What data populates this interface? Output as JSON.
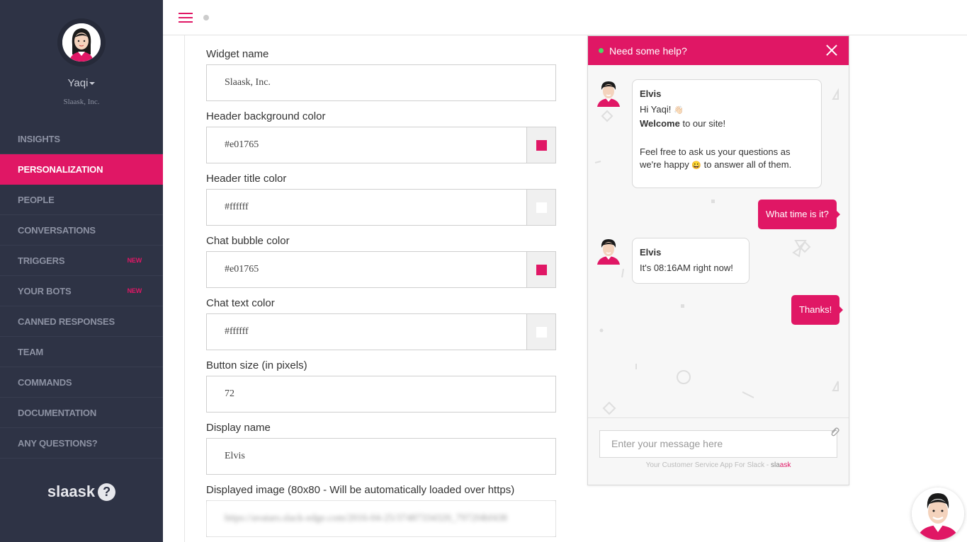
{
  "sidebar": {
    "user": {
      "name": "Yaqi",
      "org": "Slaask, Inc."
    },
    "items": [
      {
        "label": "INSIGHTS",
        "badge": ""
      },
      {
        "label": "PERSONALIZATION",
        "badge": ""
      },
      {
        "label": "PEOPLE",
        "badge": ""
      },
      {
        "label": "CONVERSATIONS",
        "badge": ""
      },
      {
        "label": "TRIGGERS",
        "badge": "NEW"
      },
      {
        "label": "YOUR BOTS",
        "badge": "NEW"
      },
      {
        "label": "CANNED RESPONSES",
        "badge": ""
      },
      {
        "label": "TEAM",
        "badge": ""
      },
      {
        "label": "COMMANDS",
        "badge": ""
      },
      {
        "label": "DOCUMENTATION",
        "badge": ""
      },
      {
        "label": "ANY QUESTIONS?",
        "badge": ""
      }
    ],
    "brand": "slaask",
    "brand_mark": "?"
  },
  "form": {
    "widget_name": {
      "label": "Widget name",
      "value": "Slaask, Inc."
    },
    "header_bg_color": {
      "label": "Header background color",
      "value": "#e01765"
    },
    "header_title_color": {
      "label": "Header title color",
      "value": "#ffffff"
    },
    "chat_bubble_color": {
      "label": "Chat bubble color",
      "value": "#e01765"
    },
    "chat_text_color": {
      "label": "Chat text color",
      "value": "#ffffff"
    },
    "button_size": {
      "label": "Button size (in pixels)",
      "value": "72"
    },
    "display_name": {
      "label": "Display name",
      "value": "Elvis"
    },
    "displayed_image": {
      "label": "Displayed image (80x80 - Will be automatically loaded over https)",
      "value": "https://avatars.slack-edge.com/2016-04-25/37487334320_7972f4bf438"
    }
  },
  "widget": {
    "title": "Need some help?",
    "messages": [
      {
        "sender": "Elvis",
        "line1_prefix": "Hi Yaqi! ",
        "line1_emoji": "👋🏻",
        "line2_bold": "Welcome",
        "line2_rest": " to our site!",
        "line3": "Feel free to ask us your questions as",
        "line4_prefix": "we're happy ",
        "line4_emoji": "😀",
        "line4_rest": " to answer all of them."
      },
      {
        "text": "What time is it?"
      },
      {
        "sender": "Elvis",
        "text": "It's 08:16AM right now!"
      },
      {
        "text": "Thanks!"
      }
    ],
    "input_placeholder": "Enter your message here",
    "powered_prefix": "Your Customer Service App For Slack - ",
    "powered_brand_a": "sla",
    "powered_brand_b": "ask"
  },
  "colors": {
    "accent": "#e01765",
    "sidebar_bg": "#2e3345",
    "white": "#ffffff"
  },
  "icons": [
    "hamburger-icon",
    "status-dot-icon",
    "close-icon",
    "paperclip-icon",
    "caret-down-icon",
    "help-icon"
  ]
}
